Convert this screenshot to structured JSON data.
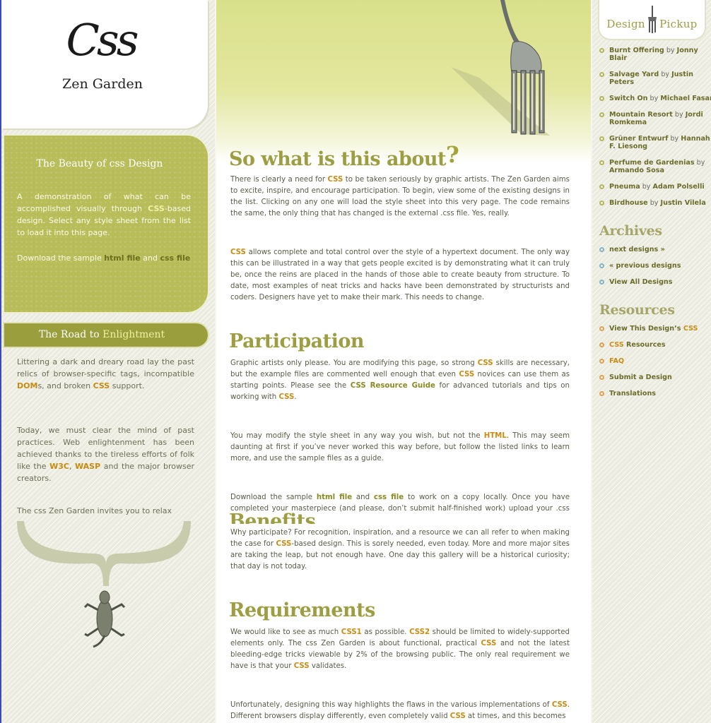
{
  "colors": {
    "olive_accent": "#9d9d42",
    "orange_accent": "#c98b14",
    "beauty_box": "#b8bd5a",
    "road_bar": "#9a9e3c",
    "hero_green": "#d9e08a"
  },
  "logo": {
    "mark": "Css",
    "name": "Zen Garden"
  },
  "beauty": {
    "title": "The Beauty of css Design",
    "p1_a": "A demonstration of what can be accomplished visually through ",
    "p1_b": "CSS",
    "p1_c": "-based design. Select any style sheet from the list to load it into this page.",
    "p2_a": "Download the sample ",
    "p2_b": "html file",
    "p2_c": " and ",
    "p2_d": "css file"
  },
  "road": {
    "title_a": "The Road to ",
    "title_b": "Enlightment",
    "p1_a": "Littering a dark and dreary road lay the past relics of browser-specific tags, incompatible ",
    "p1_b": "DOM",
    "p1_c": "s, and broken ",
    "p1_d": "CSS",
    "p1_e": " support.",
    "p2_a": "Today, we must clear the mind of past practices. Web enlightenment has been achieved thanks to the tireless efforts of folk like the ",
    "p2_b": "W3C",
    "p2_c": ", ",
    "p2_d": "WASP",
    "p2_e": " and the major browser creators.",
    "p3": "The css Zen Garden invites you to relax"
  },
  "main": {
    "about": {
      "heading": "So what is this about",
      "q": "?",
      "p1_a": "There is clearly a need for ",
      "p1_b": "CSS",
      "p1_c": " to be taken seriously by graphic artists. The Zen Garden aims to excite, inspire, and encourage participation. To begin, view some of the existing designs in the list. Clicking on any one will load the style sheet into this very page. The code remains the same, the only thing that has changed is the external .css file. Yes, really.",
      "p2_a": "CSS",
      "p2_b": " allows complete and total control over the style of a hypertext document. The only way this can be illustrated in a way that gets people excited is by demonstrating what it can truly be, once the reins are placed in the hands of those able to create beauty from structure. To date, most examples of neat tricks and hacks have been demonstrated by structurists and coders. Designers have yet to make their mark. This needs to change."
    },
    "participation": {
      "heading": "Participation",
      "p1_a": "Graphic artists only please. You are modifying this page, so strong ",
      "p1_b": "CSS",
      "p1_c": " skills are necessary, but the example files are commented well enough that even ",
      "p1_d": "CSS",
      "p1_e": " novices can use them as starting points. Please see the ",
      "p1_f": "CSS Resource Guide",
      "p1_g": " for advanced tutorials and tips on working with ",
      "p1_h": "CSS",
      "p1_i": ".",
      "p2_a": "You may modify the style sheet in any way you wish, but not the ",
      "p2_b": "HTML",
      "p2_c": ". This may seem daunting at first if you’ve never worked this way before, but follow the listed links to learn more, and use the sample files as a guide.",
      "p3_a": "Download the sample ",
      "p3_b": "html file",
      "p3_c": " and ",
      "p3_d": "css file",
      "p3_e": " to work on a copy locally. Once you have completed your masterpiece (and please, don’t submit half-finished work) upload your .css file to a web"
    },
    "benefits": {
      "heading": "Benefits",
      "p1_a": "Why participate? For recognition, inspiration, and a resource we can all refer to when making the case for ",
      "p1_b": "CSS",
      "p1_c": "-based design. This is sorely needed, even today. More and more major sites are taking the leap, but not enough have. One day this gallery will be a historical curiosity; that day is not today."
    },
    "requirements": {
      "heading": "Requirements",
      "p1_a": "We would like to see as much ",
      "p1_b": "CSS1",
      "p1_c": " as possible. ",
      "p1_d": "CSS2",
      "p1_e": " should be limited to widely-supported elements only. The css Zen Garden is about functional, practical ",
      "p1_f": "CSS",
      "p1_g": " and not the latest bleeding-edge tricks viewable by 2% of the browsing public. The only real requirement we have is that your ",
      "p1_h": "CSS",
      "p1_i": " validates.",
      "p2_a": "Unfortunately, designing this way highlights the flaws in the various implementations of ",
      "p2_b": "CSS",
      "p2_c": ". Different browsers display differently, even completely valid ",
      "p2_d": "CSS",
      "p2_e": " at times, and this becomes"
    }
  },
  "right": {
    "pickup_a": "Design",
    "pickup_b": "Pickup",
    "designs": [
      {
        "title": "Burnt Offering",
        "by": " by ",
        "author": "Jonny Blair"
      },
      {
        "title": "Salvage Yard",
        "by": " by ",
        "author": "Justin Peters"
      },
      {
        "title": "Switch On",
        "by": " by ",
        "author": "Michael Fasani"
      },
      {
        "title": "Mountain Resort",
        "by": " by ",
        "author": "Jordi Romkema"
      },
      {
        "title": "Grüner Entwurf",
        "by": " by ",
        "author": "Hannah F. Liesong"
      },
      {
        "title": "Perfume de Gardenias",
        "by": " by ",
        "author": "Armando Sosa"
      },
      {
        "title": "Pneuma",
        "by": " by ",
        "author": "Adam Polselli"
      },
      {
        "title": "Birdhouse",
        "by": " by ",
        "author": "Justin Vilela"
      }
    ],
    "archives_heading": "Archives",
    "archives": [
      "next designs »",
      "« previous designs",
      "View All Designs"
    ],
    "resources_heading": "Resources",
    "resources": {
      "view_a": "View This Design’s ",
      "view_b": "CSS",
      "css_res_a": "CSS",
      "css_res_b": " Resources",
      "faq": "FAQ",
      "submit": "Submit a Design",
      "translations": "Translations"
    }
  }
}
